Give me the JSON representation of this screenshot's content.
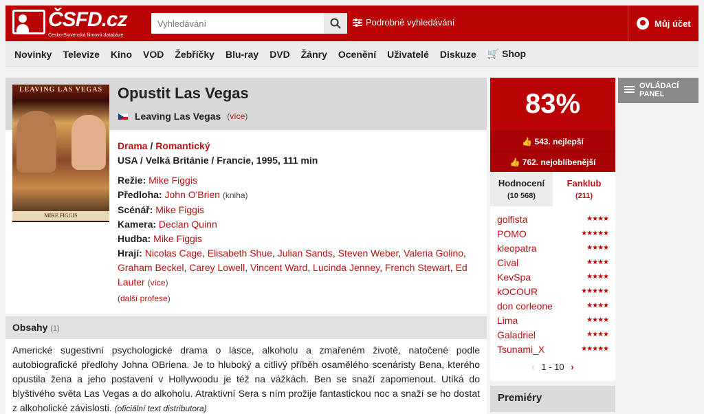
{
  "header": {
    "logo_text": "ČSFD.cz",
    "logo_subtitle": "Česko-Slovenská filmová databáze",
    "search_placeholder": "Vyhledávání",
    "advanced_search": "Podrobné vyhledávání",
    "account": "Můj účet"
  },
  "nav": [
    "Novinky",
    "Televize",
    "Kino",
    "VOD",
    "Žebříčky",
    "Blu-ray",
    "DVD",
    "Žánry",
    "Ocenění",
    "Uživatelé",
    "Diskuze",
    "Shop"
  ],
  "film": {
    "poster_title": "LEAVING LAS VEGAS",
    "poster_director": "MIKE FIGGIS",
    "title": "Opustit Las Vegas",
    "original_title": "Leaving Las Vegas",
    "more_label": "více",
    "genre_1": "Drama",
    "genre_sep": " / ",
    "genre_2": "Romantický",
    "origin": "USA / Velká Británie / Francie, 1995, 111 min",
    "director_label": "Režie:",
    "director": "Mike Figgis",
    "source_label": "Předloha:",
    "source": "John O'Brien",
    "source_note": "(kniha)",
    "writer_label": "Scénář:",
    "writer": "Mike Figgis",
    "camera_label": "Kamera:",
    "camera": "Declan Quinn",
    "music_label": "Hudba:",
    "music": "Mike Figgis",
    "cast_label": "Hrají:",
    "cast": [
      "Nicolas Cage",
      "Elisabeth Shue",
      "Julian Sands",
      "Steven Weber",
      "Valeria Golino",
      "Graham Beckel",
      "Carey Lowell",
      "Vincent Ward",
      "Lucinda Jenney",
      "French Stewart",
      "Ed Lauter"
    ],
    "more_cast": "více",
    "other_roles": "další profese"
  },
  "plot": {
    "heading": "Obsahy",
    "count": "(1)",
    "text": "Americké sugestivní psychologické drama o lásce, alkoholu a zmařeném životě, natočené podle autobiografické předlohy Johna OBriena. Je to hluboký a citlivý příběh osamělého scenáristy Bena, kterého opustila žena a jeho postavení v Hollywoodu je též na vážkách. Ben se snaží zapomenout. Utíká do blyštivého světa Las Vegas a do alkoholu. Atraktivní Sera s ním prožije fantastickou noc a snaží se ho dostat z alkoholické závislosti.",
    "source": "(oficiální text distributora)"
  },
  "rating": {
    "percent": "83%",
    "best_rank": "543. nejlepší",
    "fav_rank": "762. nejoblíbenější",
    "tab_ratings": "Hodnocení",
    "tab_ratings_count": "(10 568)",
    "tab_fanclub": "Fanklub",
    "tab_fanclub_count": "(211)",
    "raters": [
      {
        "name": "golfista",
        "stars": 4
      },
      {
        "name": "POMO",
        "stars": 5
      },
      {
        "name": "kleopatra",
        "stars": 4
      },
      {
        "name": "Cival",
        "stars": 4
      },
      {
        "name": "KevSpa",
        "stars": 4
      },
      {
        "name": "kOCOUR",
        "stars": 5
      },
      {
        "name": "don corleone",
        "stars": 4
      },
      {
        "name": "Lima",
        "stars": 4
      },
      {
        "name": "Galadriel",
        "stars": 4
      },
      {
        "name": "Tsunami_X",
        "stars": 5
      }
    ],
    "pager": "1 - 10"
  },
  "premiere": "Premiéry",
  "control_panel": "OVLÁDACÍ PANEL",
  "colors": {
    "brand": "#ba0305",
    "link": "#b11"
  }
}
